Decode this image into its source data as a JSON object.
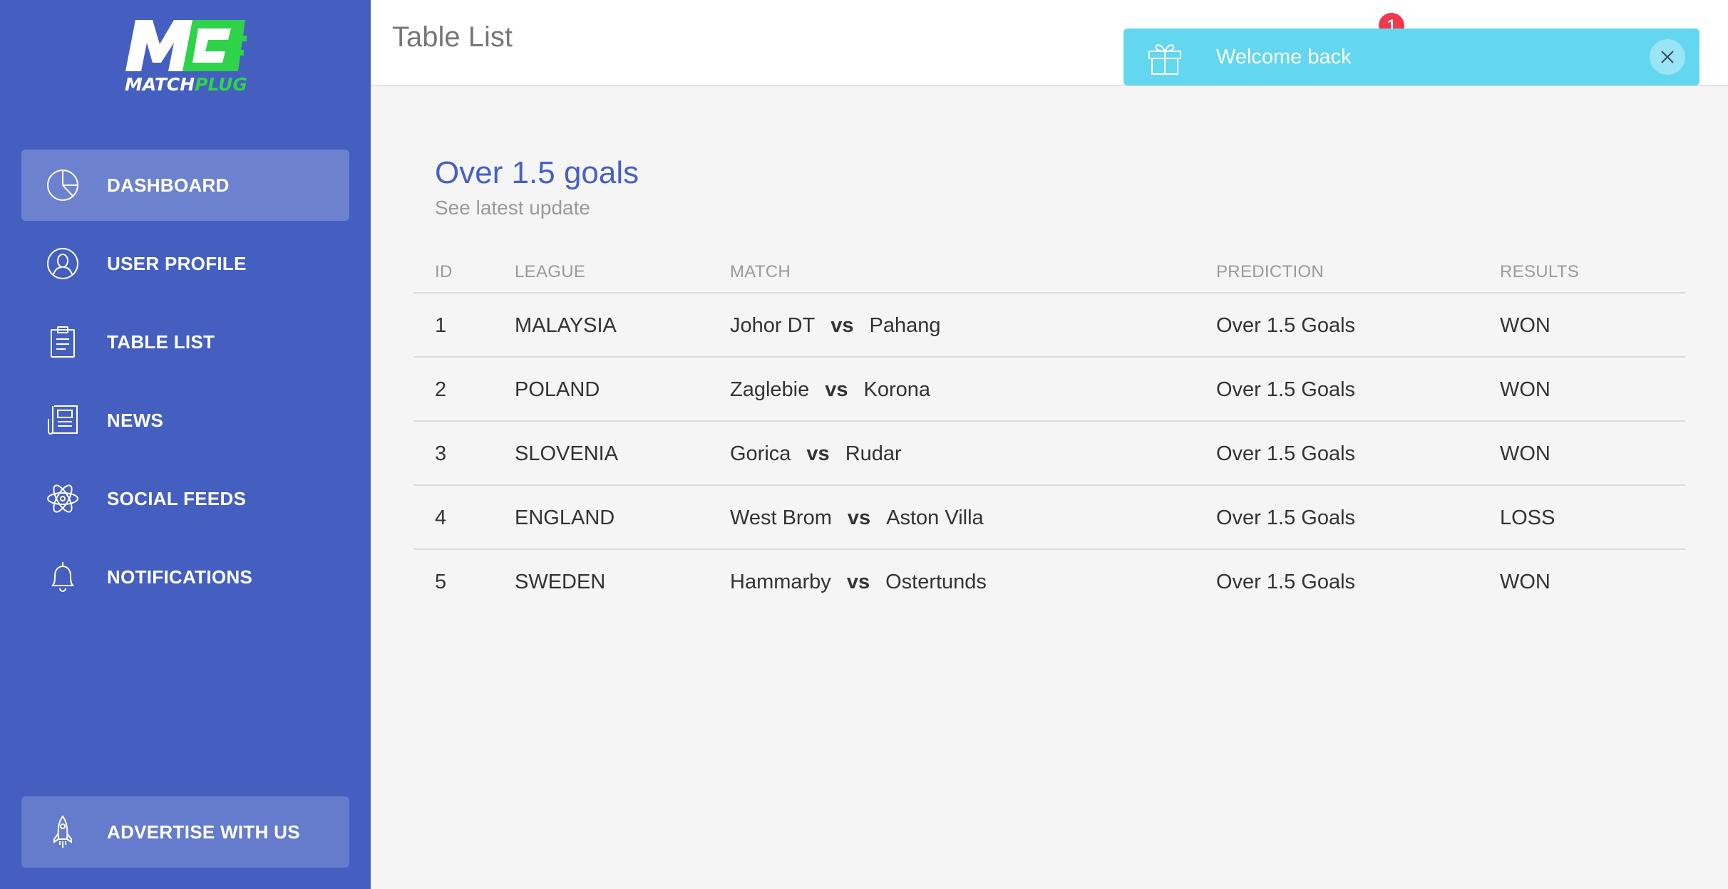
{
  "brand": {
    "logo_text_white": "MATCH",
    "logo_text_green": "PLUG",
    "colors": {
      "sidebar": "#445fc0",
      "green": "#2fd34a",
      "toast": "#63d6f0",
      "accent_title": "#4760c2",
      "badge": "#f0394a"
    }
  },
  "sidebar": {
    "items": [
      {
        "label": "DASHBOARD",
        "icon": "pie-chart-icon",
        "active": true
      },
      {
        "label": "USER PROFILE",
        "icon": "user-icon",
        "active": false
      },
      {
        "label": "TABLE LIST",
        "icon": "clipboard-icon",
        "active": false
      },
      {
        "label": "NEWS",
        "icon": "newspaper-icon",
        "active": false
      },
      {
        "label": "SOCIAL FEEDS",
        "icon": "atom-icon",
        "active": false
      },
      {
        "label": "NOTIFICATIONS",
        "icon": "bell-icon",
        "active": false
      }
    ],
    "advertise": {
      "label": "ADVERTISE WITH US",
      "icon": "rocket-icon"
    }
  },
  "header": {
    "title": "Table List",
    "notification_count": "1"
  },
  "toast": {
    "message": "Welcome back",
    "icon": "gift-icon"
  },
  "card": {
    "title": "Over 1.5 goals",
    "subtitle": "See latest update",
    "columns": [
      "ID",
      "LEAGUE",
      "MATCH",
      "PREDICTION",
      "RESULTS"
    ],
    "rows": [
      {
        "id": "1",
        "league": "MALAYSIA",
        "home": "Johor DT",
        "vs": "vs",
        "away": "Pahang",
        "prediction": "Over 1.5 Goals",
        "result": "WON"
      },
      {
        "id": "2",
        "league": "POLAND",
        "home": "Zaglebie",
        "vs": "vs",
        "away": "Korona",
        "prediction": "Over 1.5 Goals",
        "result": "WON"
      },
      {
        "id": "3",
        "league": "SLOVENIA",
        "home": "Gorica",
        "vs": "vs",
        "away": "Rudar",
        "prediction": "Over 1.5 Goals",
        "result": "WON"
      },
      {
        "id": "4",
        "league": "ENGLAND",
        "home": "West Brom",
        "vs": "vs",
        "away": "Aston Villa",
        "prediction": "Over 1.5 Goals",
        "result": "LOSS"
      },
      {
        "id": "5",
        "league": "SWEDEN",
        "home": "Hammarby",
        "vs": "vs",
        "away": "Ostertunds",
        "prediction": "Over 1.5 Goals",
        "result": "WON"
      }
    ]
  }
}
